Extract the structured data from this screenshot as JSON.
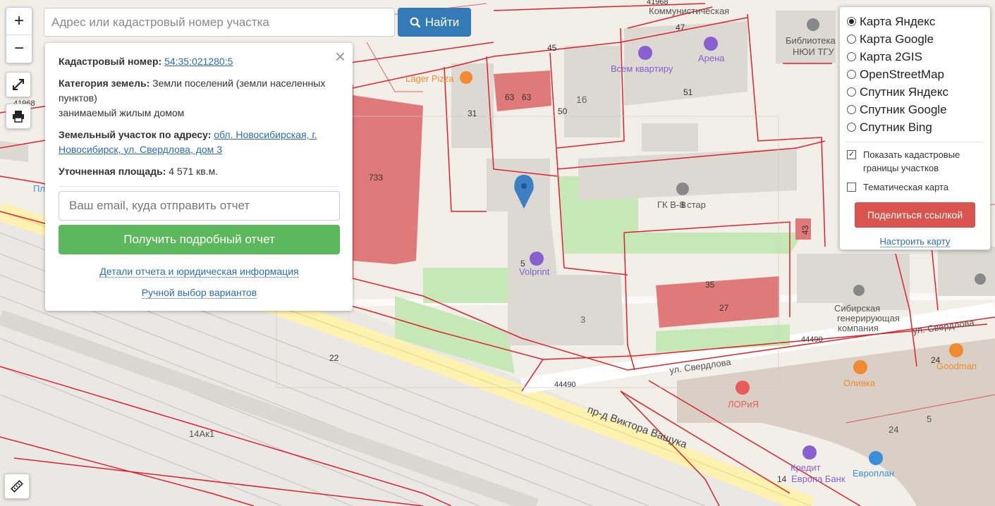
{
  "toolbar": {
    "zoom_in": "+",
    "zoom_out": "−",
    "search_placeholder": "Адрес или кадастровый номер участка",
    "find_label": "Найти"
  },
  "popup": {
    "cadastral_label": "Кадастровый номер:",
    "cadastral_value": "54:35:021280:5",
    "category_label": "Категория земель:",
    "category_value": "Земли поселений (земли населенных пунктов)",
    "category_sub": "занимаемый жилым домом",
    "address_label": "Земельный участок по адресу:",
    "address_value": "обл. Новосибирская, г. Новосибирск, ул. Свердлова, дом 3",
    "area_label": "Уточненная площадь:",
    "area_value": "4 571 кв.м.",
    "email_placeholder": "Ваш email, куда отправить отчет",
    "report_button": "Получить подробный отчет",
    "details_link": "Детали отчета и юридическая информация",
    "manual_link": "Ручной выбор вариантов"
  },
  "layers": {
    "options": [
      {
        "label": "Карта Яндекс",
        "selected": true
      },
      {
        "label": "Карта Google",
        "selected": false
      },
      {
        "label": "Карта 2GIS",
        "selected": false
      },
      {
        "label": "OpenStreetMap",
        "selected": false
      },
      {
        "label": "Спутник Яндекс",
        "selected": false
      },
      {
        "label": "Спутник Google",
        "selected": false
      },
      {
        "label": "Спутник Bing",
        "selected": false
      }
    ],
    "show_boundaries": {
      "label": "Показать кадастровые границы участков",
      "checked": true
    },
    "thematic": {
      "label": "Тематическая карта",
      "checked": false
    },
    "share_button": "Поделиться ссылкой",
    "configure_link": "Настроить карту"
  },
  "map": {
    "labels": {
      "cadastre_41968": "41968",
      "street_top": "Коммунистическая",
      "library": "Библиотека",
      "library2": "НЮИ ТГУ",
      "arena": "Арена",
      "vsem": "Всем квартиру",
      "lager": "Lager Pizza",
      "volprint": "Volprint",
      "gk": "ГК В-8 стар",
      "sib1": "Сибирская",
      "sib2": "генерирующая",
      "sib3": "компания",
      "sverdlova1": "ул. Свердлова",
      "sverdlova2": "ул. Свердлова",
      "cad44490a": "44490",
      "cad44490b": "44490",
      "vashchuka": "пр-д Виктора Ващука",
      "ak": "14Ак1",
      "goodman": "Goodman",
      "olivka": "Оливка",
      "loria": "ЛОРиЯ",
      "kredit1": "Кредит",
      "kredit2": "Европа Банк",
      "evroplan": "Европлан",
      "pl": "Пл"
    },
    "numbers": [
      "47",
      "45",
      "51",
      "16",
      "50",
      "63",
      "63",
      "31",
      "733",
      "5",
      "3",
      "35",
      "27",
      "43",
      "22",
      "24",
      "24",
      "5",
      "14",
      "8"
    ],
    "colors": {
      "boundary": "#e0212b",
      "building_hl": "#e07a7a",
      "building": "#dcd8d2",
      "road": "#ffffff",
      "green": "#c6e8b6",
      "marker": "#3b7fc4"
    }
  }
}
